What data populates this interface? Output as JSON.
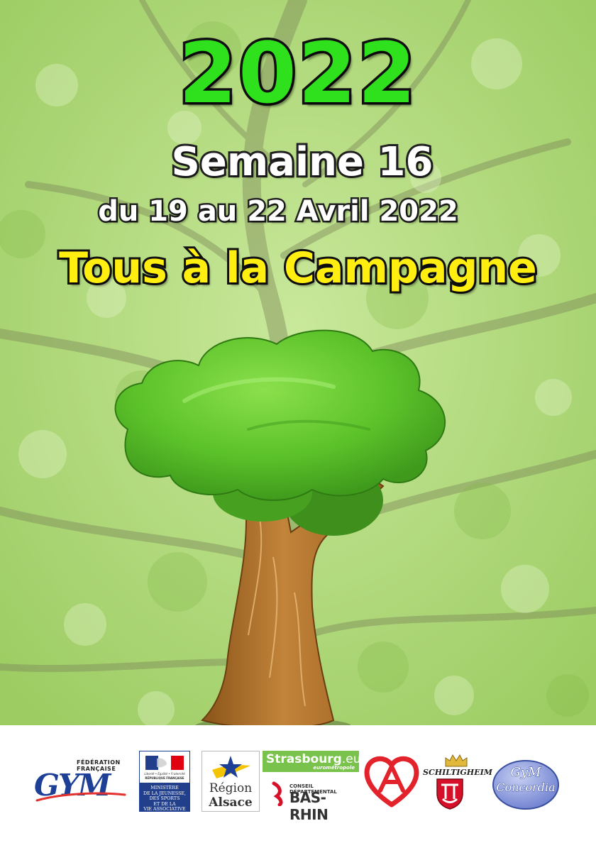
{
  "header": {
    "year": "2022",
    "week": "Semaine 16",
    "dates": "du 19 au 22 Avril 2022",
    "theme": "Tous à la Campagne"
  },
  "colors": {
    "year_fill": "#2fe01c",
    "theme_fill": "#ffee10",
    "background_leaves": "#a9d56f",
    "tree_foliage": "#5ec42c",
    "tree_trunk": "#b97a2f"
  },
  "illustration": {
    "icon": "tree-icon"
  },
  "sponsors": {
    "ffgym": {
      "small": "FÉDÉRATION FRANÇAISE",
      "name": "GYM"
    },
    "ministry": {
      "motto": "Liberté • Égalité • Fraternité",
      "republic": "RÉPUBLIQUE FRANÇAISE",
      "text_l1": "MINISTÈRE",
      "text_l2": "DE LA JEUNESSE,",
      "text_l3": "DES SPORTS",
      "text_l4": "ET DE LA",
      "text_l5": "VIE ASSOCIATIVE"
    },
    "alsace": {
      "line1": "Région",
      "line2": "Alsace"
    },
    "strasbourg": {
      "name": "Strasbourg",
      "ext": ".eu",
      "sub": "eurométropole"
    },
    "basrhin": {
      "line1": "CONSEIL DÉPARTEMENTAL",
      "line2": "BAS-RHIN"
    },
    "schiltigheim": {
      "name": "SCHILTIGHEIM"
    },
    "concordia": {
      "line1": "GyM",
      "line2": "Concordia"
    }
  }
}
